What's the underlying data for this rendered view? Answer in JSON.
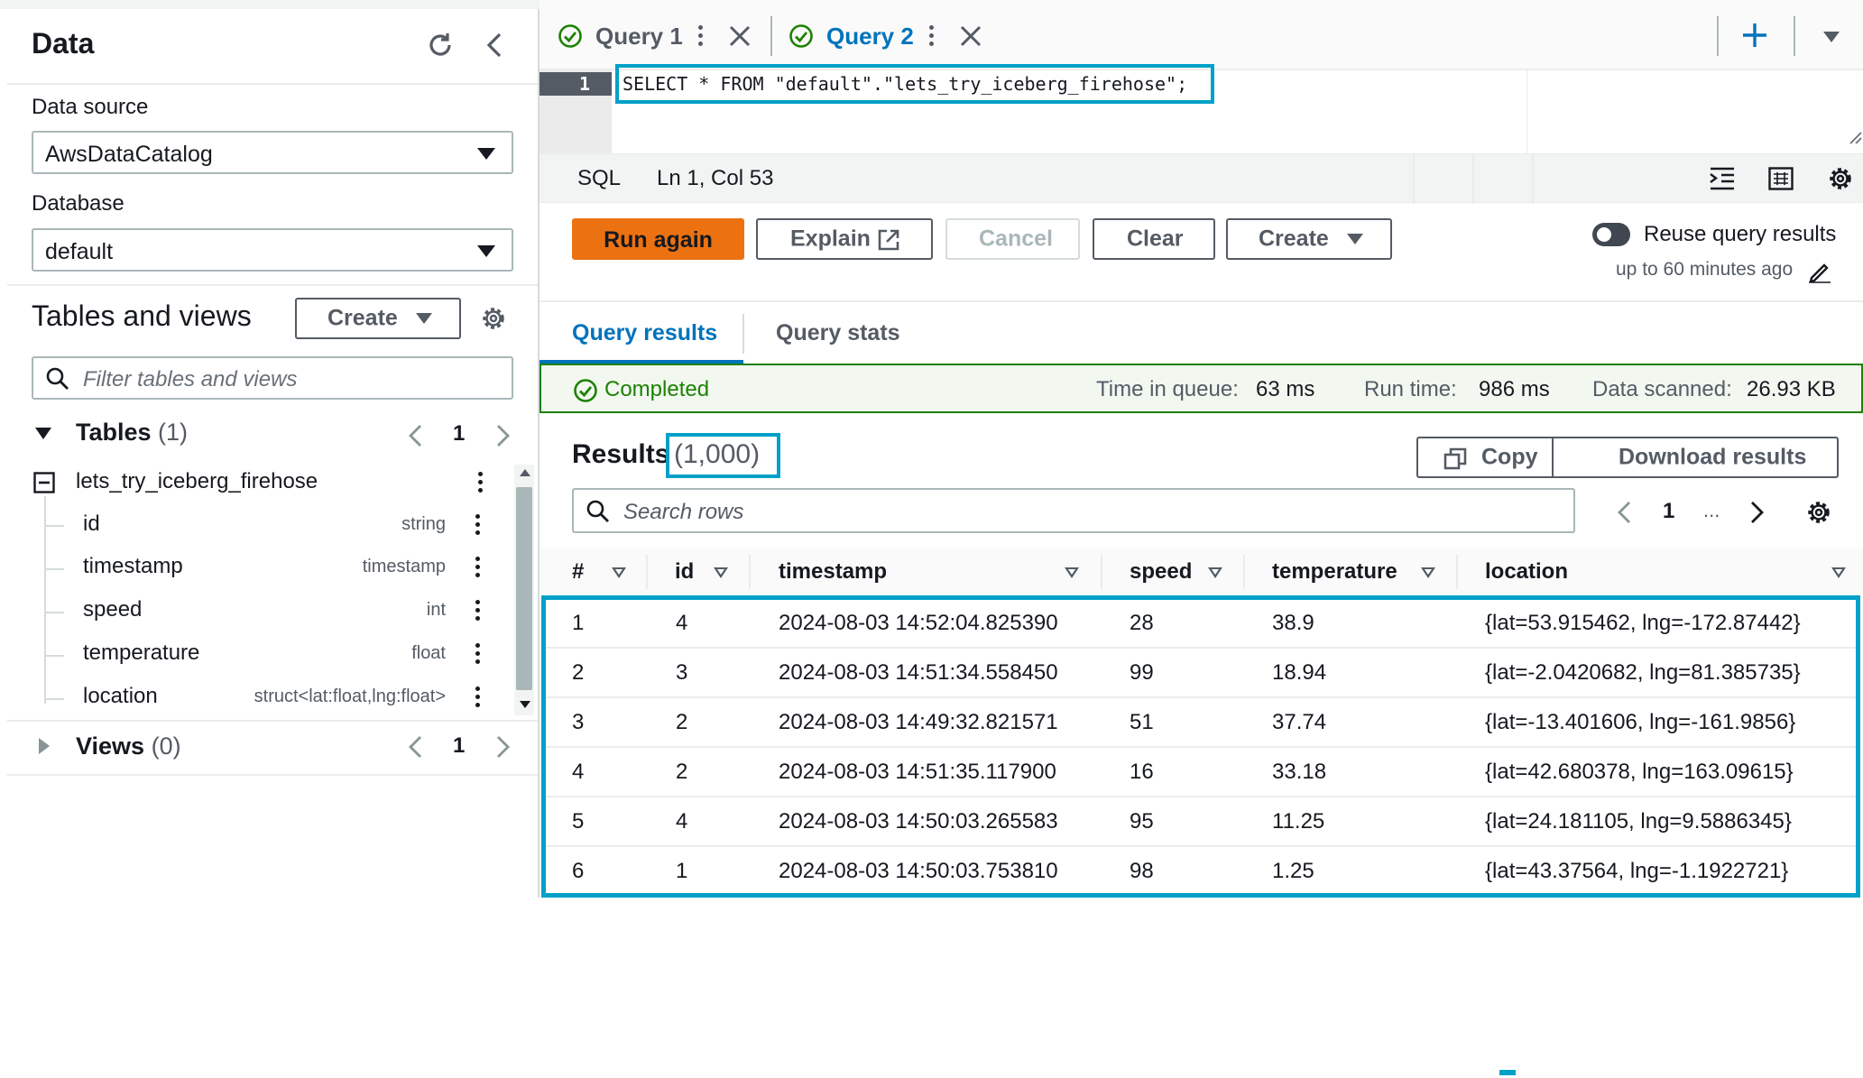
{
  "left_panel": {
    "title": "Data",
    "data_source_label": "Data source",
    "data_source_value": "AwsDataCatalog",
    "database_label": "Database",
    "database_value": "default",
    "tables_views_title": "Tables and views",
    "create_label": "Create",
    "filter_placeholder": "Filter tables and views",
    "tables_label": "Tables",
    "tables_count": "(1)",
    "tables_page": "1",
    "table_name": "lets_try_iceberg_firehose",
    "columns": [
      {
        "name": "id",
        "type": "string"
      },
      {
        "name": "timestamp",
        "type": "timestamp"
      },
      {
        "name": "speed",
        "type": "int"
      },
      {
        "name": "temperature",
        "type": "float"
      },
      {
        "name": "location",
        "type": "struct<lat:float,lng:float>"
      }
    ],
    "views_label": "Views",
    "views_count": "(0)",
    "views_page": "1"
  },
  "tabs": [
    {
      "label": "Query 1",
      "status": "success",
      "active": false
    },
    {
      "label": "Query 2",
      "status": "success",
      "active": true
    }
  ],
  "editor": {
    "line_number": "1",
    "query": "SELECT * FROM \"default\".\"lets_try_iceberg_firehose\";"
  },
  "statusbar": {
    "language": "SQL",
    "position": "Ln 1, Col 53"
  },
  "actions": {
    "run_again": "Run again",
    "explain": "Explain",
    "cancel": "Cancel",
    "clear": "Clear",
    "create": "Create",
    "reuse_label": "Reuse query results",
    "reuse_sub": "up to 60 minutes ago"
  },
  "result_tabs": {
    "query_results": "Query results",
    "query_stats": "Query stats"
  },
  "status": {
    "completed": "Completed",
    "queue_label": "Time in queue:",
    "queue_value": "63 ms",
    "run_label": "Run time:",
    "run_value": "986 ms",
    "scanned_label": "Data scanned:",
    "scanned_value": "26.93 KB"
  },
  "results": {
    "title": "Results",
    "count": "(1,000)",
    "copy": "Copy",
    "download": "Download results",
    "search_placeholder": "Search rows",
    "page": "1",
    "ellipsis": "..."
  },
  "table": {
    "headers": [
      "#",
      "id",
      "timestamp",
      "speed",
      "temperature",
      "location"
    ],
    "rows": [
      [
        "1",
        "4",
        "2024-08-03 14:52:04.825390",
        "28",
        "38.9",
        "{lat=53.915462, lng=-172.87442}"
      ],
      [
        "2",
        "3",
        "2024-08-03 14:51:34.558450",
        "99",
        "18.94",
        "{lat=-2.0420682, lng=81.385735}"
      ],
      [
        "3",
        "2",
        "2024-08-03 14:49:32.821571",
        "51",
        "37.74",
        "{lat=-13.401606, lng=-161.9856}"
      ],
      [
        "4",
        "2",
        "2024-08-03 14:51:35.117900",
        "16",
        "33.18",
        "{lat=42.680378, lng=163.09615}"
      ],
      [
        "5",
        "4",
        "2024-08-03 14:50:03.265583",
        "95",
        "11.25",
        "{lat=24.181105, lng=9.5886345}"
      ],
      [
        "6",
        "1",
        "2024-08-03 14:50:03.753810",
        "98",
        "1.25",
        "{lat=43.37564, lng=-1.1922721}"
      ]
    ]
  },
  "colors": {
    "accent": "#0073bb",
    "primary_button": "#ec7211",
    "success": "#1d8102",
    "highlight": "#00a1c9"
  }
}
